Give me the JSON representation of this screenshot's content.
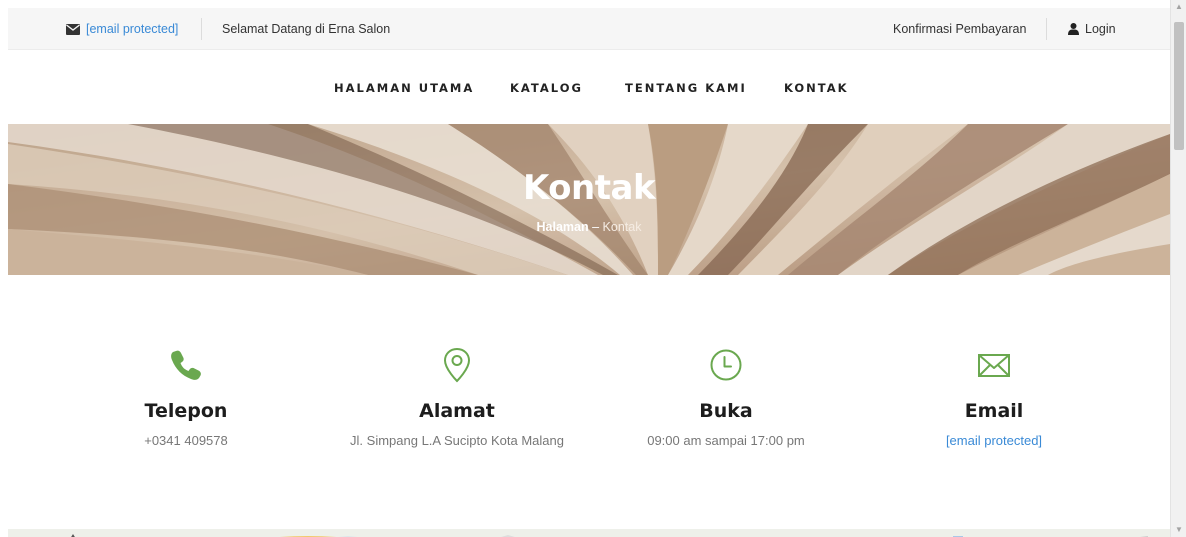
{
  "topbar": {
    "email": "[email protected]",
    "welcome": "Selamat Datang di Erna Salon",
    "confirm_payment": "Konfirmasi Pembayaran",
    "login": "Login"
  },
  "nav": {
    "items": [
      {
        "label": "HALAMAN UTAMA"
      },
      {
        "label": "KATALOG"
      },
      {
        "label": "TENTANG KAMI"
      },
      {
        "label": "KONTAK"
      }
    ]
  },
  "hero": {
    "title": "Kontak",
    "breadcrumb": {
      "parent": "Halaman",
      "separator": " – ",
      "current": "Kontak"
    }
  },
  "contact": {
    "icon_color": "#6aa84f",
    "items": [
      {
        "icon": "phone-icon",
        "title": "Telepon",
        "value": "+0341 409578"
      },
      {
        "icon": "map-pin-icon",
        "title": "Alamat",
        "value": "Jl. Simpang L.A Sucipto Kota Malang"
      },
      {
        "icon": "clock-icon",
        "title": "Buka",
        "value": "09:00 am sampai 17:00 pm"
      },
      {
        "icon": "envelope-icon",
        "title": "Email",
        "value": "[email protected]"
      }
    ]
  },
  "colors": {
    "accent_green": "#6aa84f",
    "link_blue": "#3a8ad6",
    "topbar_bg": "#f6f6f6"
  }
}
